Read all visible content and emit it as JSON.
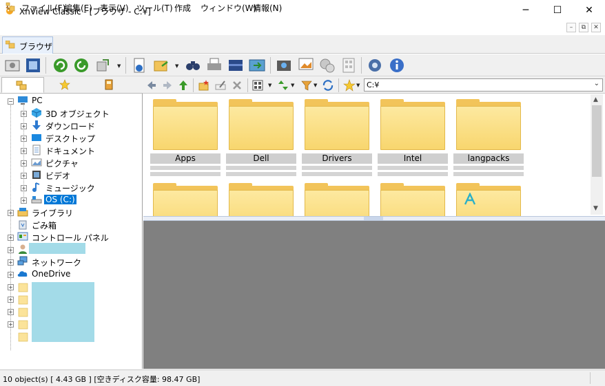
{
  "window": {
    "title": "XnView Classic - [ブラウザ - C:¥]",
    "minimize": "─",
    "maximize": "☐",
    "close": "✕"
  },
  "menu": {
    "items": [
      "ファイル(F)",
      "編集(E)",
      "表示(V)",
      "ツール(T)",
      "作成",
      "ウィンドウ(W)",
      "情報(N)"
    ],
    "mdi_buttons": [
      "–",
      "⧉",
      "✕"
    ]
  },
  "tabs": [
    {
      "label": "ブラウザ",
      "icon": "browser-folder-icon"
    }
  ],
  "toolbar": {
    "icons": [
      "fullscreen-icon",
      "slideshow-icon",
      "refresh-icon",
      "reload-icon",
      "rotate-icon",
      "info-icon",
      "export-icon",
      "binoculars-icon",
      "print-icon",
      "scanner-icon",
      "convert-icon",
      "capture-icon",
      "gallery-icon",
      "web-icon",
      "contact-sheet-icon",
      "settings-icon",
      "about-icon"
    ]
  },
  "left_tabs": [
    "folders-tab-icon",
    "favorites-tab-icon",
    "categories-tab-icon"
  ],
  "navbar": {
    "path": "C:¥"
  },
  "tree": {
    "pc": "PC",
    "pc_children": [
      "3D オブジェクト",
      "ダウンロード",
      "デスクトップ",
      "ドキュメント",
      "ピクチャ",
      "ビデオ",
      "ミュージック",
      "OS (C:)"
    ],
    "top_level": [
      "ライブラリ",
      "ごみ箱",
      "コントロール パネル",
      "",
      "ネットワーク",
      "OneDrive"
    ]
  },
  "thumbnails": {
    "row1": [
      "Apps",
      "Dell",
      "Drivers",
      "Intel",
      "langpacks"
    ],
    "row2": [
      "",
      "",
      "",
      "",
      ""
    ]
  },
  "status": {
    "text": "10 object(s) [ 4.43 GB ] [空きディスク容量: 98.47 GB]"
  },
  "colors": {
    "selection": "#0078d7",
    "folder": "#f8d66e",
    "preview_bg": "#808080",
    "redacted": "#a3dbe8"
  }
}
